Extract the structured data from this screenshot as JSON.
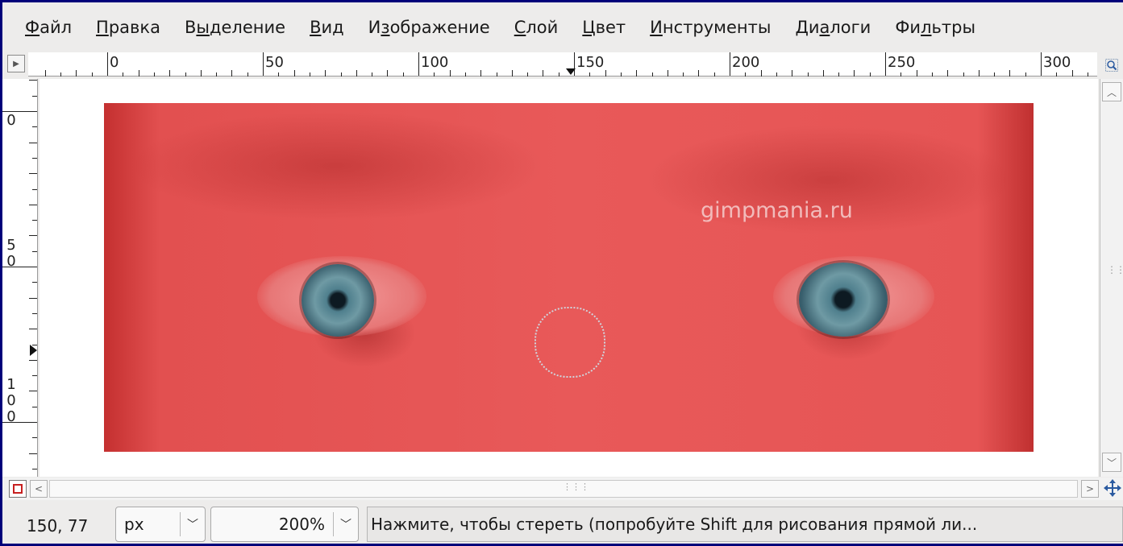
{
  "menu": [
    {
      "pre": "",
      "mn": "Ф",
      "post": "айл"
    },
    {
      "pre": "",
      "mn": "П",
      "post": "равка"
    },
    {
      "pre": "В",
      "mn": "ы",
      "post": "деление"
    },
    {
      "pre": "",
      "mn": "В",
      "post": "ид"
    },
    {
      "pre": "И",
      "mn": "з",
      "post": "ображение"
    },
    {
      "pre": "",
      "mn": "С",
      "post": "лой"
    },
    {
      "pre": "",
      "mn": "Ц",
      "post": "вет"
    },
    {
      "pre": "",
      "mn": "И",
      "post": "нструменты"
    },
    {
      "pre": "Ди",
      "mn": "а",
      "post": "логи"
    },
    {
      "pre": "Фи",
      "mn": "л",
      "post": "ьтры"
    }
  ],
  "hruler_labels": [
    "0",
    "50",
    "100",
    "150",
    "200",
    "250",
    "300"
  ],
  "vruler_labels": [
    "0",
    "50",
    "100"
  ],
  "watermark": "gimpmania.ru",
  "status": {
    "coords": "150, 77",
    "unit": "px",
    "zoom": "200%",
    "message": "Нажмите, чтобы стереть (попробуйте Shift для рисования прямой ли..."
  },
  "icons": {
    "menu_arrow": "triangle-right-icon",
    "zoom_corner": "magnifier-icon",
    "quick_mask": "quick-mask-icon",
    "navigate": "navigate-icon"
  },
  "colors": {
    "accent": "#00007a",
    "overlay_red": "#e85959",
    "quickmask_border": "#c72020"
  }
}
